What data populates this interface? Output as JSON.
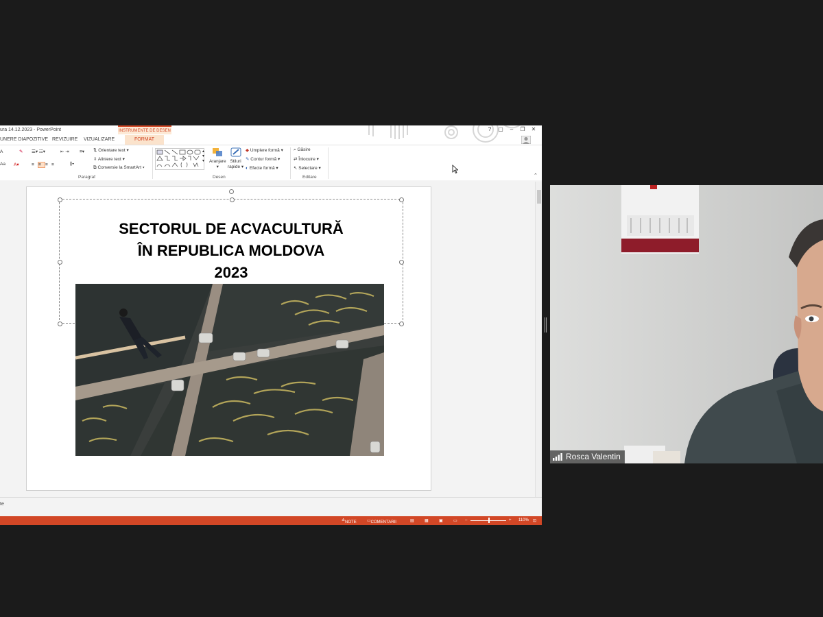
{
  "window": {
    "title": "ura 14.12.2023 - PowerPoint",
    "context_group": "INSTRUMENTE DE DESEN",
    "controls": [
      "?",
      "▢",
      "–",
      "❐",
      "✕"
    ]
  },
  "tabs": [
    {
      "label": "UNERE DIAPOZITIVE"
    },
    {
      "label": "REVIZUIRE"
    },
    {
      "label": "VIZUALIZARE"
    },
    {
      "label": "FORMAT"
    }
  ],
  "ribbon": {
    "paragraph": {
      "orient_text": "Orientare text",
      "align_text": "Aliniere text",
      "smartart": "Conversie la SmartArt",
      "label": "Paragraf"
    },
    "drawing": {
      "arrange": "Aranjare",
      "quick_styles_1": "Stiluri",
      "quick_styles_2": "rapide",
      "fill": "Umplere formă",
      "outline": "Contur formă",
      "effects": "Efecte formă",
      "label": "Desen"
    },
    "editing": {
      "find": "Găsire",
      "replace": "Înlocuire",
      "select": "Selectare",
      "label": "Editare"
    },
    "font_prefix": "A",
    "font_prefix2": "Aa"
  },
  "slide": {
    "title_lines": [
      "SECTORUL DE ACVACULTURĂ",
      "ÎN REPUBLICA MOLDOVA",
      "2023"
    ]
  },
  "notes": {
    "text": "te"
  },
  "status": {
    "notes": "NOTE",
    "comments": "COMENTARII",
    "zoom": "110%"
  },
  "webcam": {
    "name": "Rosca Valentin"
  },
  "colors": {
    "accent": "#d24726",
    "background": "#1b1b1b"
  }
}
